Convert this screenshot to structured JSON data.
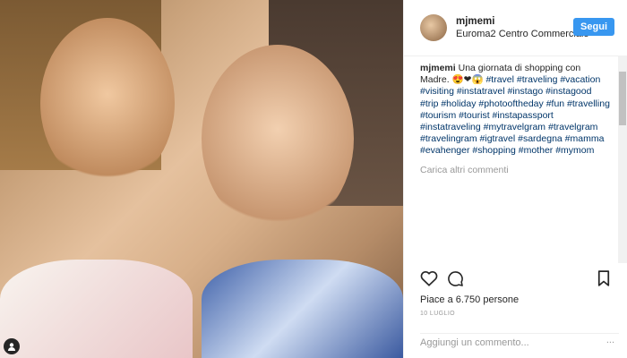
{
  "header": {
    "username": "mjmemi",
    "location": "Euroma2 Centro Commerciale",
    "follow_label": "Segui"
  },
  "caption": {
    "username": "mjmemi",
    "text": "Una giornata di shopping con Madre. 😍❤😱",
    "hashtags": "#travel #traveling #vacation #visiting #instatravel #instago #instagood #trip #holiday #photooftheday #fun #travelling #tourism #tourist #instapassport #instatraveling #mytravelgram #travelgram #travelingram #igtravel #sardegna #mamma #evahenger #shopping #mother #mymom"
  },
  "load_more": "Carica altri commenti",
  "likes": "Piace a 6.750 persone",
  "date": "10 LUGLIO",
  "add_comment_placeholder": "Aggiungi un commento...",
  "more_options": "...",
  "icons": {
    "like": "heart-icon",
    "comment": "comment-icon",
    "save": "bookmark-icon",
    "user_tag": "user-tag-icon"
  },
  "colors": {
    "follow_button": "#3897f0",
    "hashtag": "#003569"
  }
}
